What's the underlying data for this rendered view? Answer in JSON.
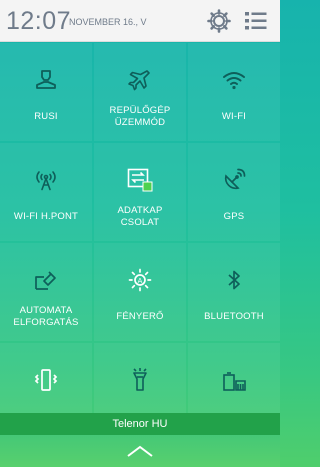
{
  "status": {
    "time": "12:07",
    "date": "NOVEMBER 16., V",
    "settings_icon": "gear-icon",
    "list_icon": "list-icon"
  },
  "tiles": [
    {
      "label": "RUSI",
      "icon": "user-icon"
    },
    {
      "label": "REPÜLŐGÉP ÜZEMMÓD",
      "icon": "airplane-icon"
    },
    {
      "label": "WI-FI",
      "icon": "wifi-icon"
    },
    {
      "label": "WI-FI H.PONT",
      "icon": "hotspot-icon"
    },
    {
      "label": "ADATKAPCSOLAT",
      "icon": "data-connection-icon"
    },
    {
      "label": "GPS",
      "icon": "satellite-icon"
    },
    {
      "label": "AUTOMATA ELFORGATÁS",
      "icon": "rotate-icon"
    },
    {
      "label": "FÉNYERŐ",
      "icon": "brightness-icon"
    },
    {
      "label": "BLUETOOTH",
      "icon": "bluetooth-icon"
    },
    {
      "label": "",
      "icon": "vibrate-icon"
    },
    {
      "label": "",
      "icon": "flashlight-icon"
    },
    {
      "label": "",
      "icon": "power-saving-icon"
    }
  ],
  "operator": "Telenor HU",
  "colors": {
    "header_bg": "#f4f4f4",
    "header_text": "#6f7b8a",
    "icon_color": "#0e5f5a",
    "operator_bar": "#22a24a"
  }
}
